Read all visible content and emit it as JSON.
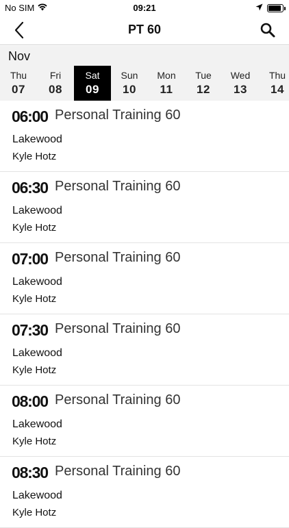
{
  "status_bar": {
    "carrier": "No SIM",
    "time": "09:21",
    "battery_level": 0.9
  },
  "nav": {
    "title": "PT 60",
    "back_icon": "chevron-left-icon",
    "search_icon": "search-icon"
  },
  "calendar": {
    "month": "Nov",
    "days": [
      {
        "name": "Thu",
        "num": "07",
        "selected": false
      },
      {
        "name": "Fri",
        "num": "08",
        "selected": false
      },
      {
        "name": "Sat",
        "num": "09",
        "selected": true
      },
      {
        "name": "Sun",
        "num": "10",
        "selected": false
      },
      {
        "name": "Mon",
        "num": "11",
        "selected": false
      },
      {
        "name": "Tue",
        "num": "12",
        "selected": false
      },
      {
        "name": "Wed",
        "num": "13",
        "selected": false
      },
      {
        "name": "Thu",
        "num": "14",
        "selected": false
      }
    ]
  },
  "sessions": [
    {
      "time": "06:00",
      "class": "Personal Training 60",
      "location": "Lakewood",
      "instructor": "Kyle Hotz"
    },
    {
      "time": "06:30",
      "class": "Personal Training 60",
      "location": "Lakewood",
      "instructor": "Kyle Hotz"
    },
    {
      "time": "07:00",
      "class": "Personal Training 60",
      "location": "Lakewood",
      "instructor": "Kyle Hotz"
    },
    {
      "time": "07:30",
      "class": "Personal Training 60",
      "location": "Lakewood",
      "instructor": "Kyle Hotz"
    },
    {
      "time": "08:00",
      "class": "Personal Training 60",
      "location": "Lakewood",
      "instructor": "Kyle Hotz"
    },
    {
      "time": "08:30",
      "class": "Personal Training 60",
      "location": "Lakewood",
      "instructor": "Kyle Hotz"
    }
  ]
}
